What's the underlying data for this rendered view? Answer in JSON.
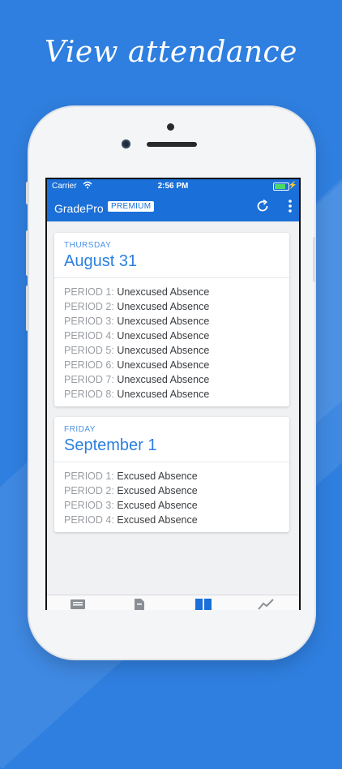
{
  "headline": "View attendance",
  "status": {
    "carrier": "Carrier",
    "time": "2:56 PM"
  },
  "appbar": {
    "title": "GradePro",
    "badge": "PREMIUM"
  },
  "colors": {
    "primary": "#1a6fd8",
    "background": "#2f7fe0",
    "day_label": "#4a90e2"
  },
  "icons": [
    "wifi-icon",
    "battery-icon",
    "refresh-icon",
    "more-vertical-icon",
    "list-icon",
    "document-icon",
    "book-icon",
    "chart-icon"
  ],
  "days": [
    {
      "weekday": "THURSDAY",
      "date": "August 31",
      "periods": [
        {
          "period": "PERIOD 1:",
          "status": "Unexcused Absence"
        },
        {
          "period": "PERIOD 2:",
          "status": "Unexcused Absence"
        },
        {
          "period": "PERIOD 3:",
          "status": "Unexcused Absence"
        },
        {
          "period": "PERIOD 4:",
          "status": "Unexcused Absence"
        },
        {
          "period": "PERIOD 5:",
          "status": "Unexcused Absence"
        },
        {
          "period": "PERIOD 6:",
          "status": "Unexcused Absence"
        },
        {
          "period": "PERIOD 7:",
          "status": "Unexcused Absence"
        },
        {
          "period": "PERIOD 8:",
          "status": "Unexcused Absence"
        }
      ]
    },
    {
      "weekday": "FRIDAY",
      "date": "September 1",
      "periods": [
        {
          "period": "PERIOD 1:",
          "status": "Excused Absence"
        },
        {
          "period": "PERIOD 2:",
          "status": "Excused Absence"
        },
        {
          "period": "PERIOD 3:",
          "status": "Excused Absence"
        },
        {
          "period": "PERIOD 4:",
          "status": "Excused Absence"
        }
      ]
    }
  ]
}
